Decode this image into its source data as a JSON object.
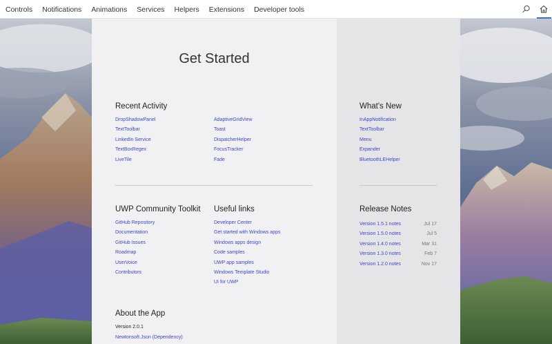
{
  "nav": {
    "items": [
      "Controls",
      "Notifications",
      "Animations",
      "Services",
      "Helpers",
      "Extensions",
      "Developer tools"
    ]
  },
  "page": {
    "title": "Get Started"
  },
  "recent_activity": {
    "title": "Recent Activity",
    "col1": [
      "DropShadowPanel",
      "TextToolbar",
      "LinkedIn Service",
      "TextBoxRegex",
      "LiveTile"
    ],
    "col2": [
      "AdaptiveGridView",
      "Toast",
      "DispatcherHelper",
      "FocusTracker",
      "Fade"
    ]
  },
  "whats_new": {
    "title": "What's New",
    "items": [
      "InAppNotification",
      "TextToolbar",
      "Menu",
      "Expander",
      "BluetoothLEHelper"
    ]
  },
  "toolkit": {
    "title": "UWP Community Toolkit",
    "items": [
      "GitHub Repository",
      "Documentation",
      "GitHub Issues",
      "Roadmap",
      "UserVoice",
      "Contributors"
    ]
  },
  "useful_links": {
    "title": "Useful links",
    "items": [
      "Developer Center",
      "Get started with Windows apps",
      "Windows apps design",
      "Code samples",
      "UWP app samples",
      "Windows Template Studio",
      "UI for UWP"
    ]
  },
  "release_notes": {
    "title": "Release Notes",
    "items": [
      {
        "name": "Version 1.5.1 notes",
        "date": "Jul 17"
      },
      {
        "name": "Version 1.5.0 notes",
        "date": "Jul 5"
      },
      {
        "name": "Version 1.4.0 notes",
        "date": "Mar 31"
      },
      {
        "name": "Version 1.3.0 notes",
        "date": "Feb 7"
      },
      {
        "name": "Version 1.2.0 notes",
        "date": "Nov 17"
      }
    ]
  },
  "about": {
    "title": "About the App",
    "version": "Version 2.0.1",
    "dependency_link": "Newtonsoft.Json (Dependency)"
  },
  "colors": {
    "link": "#3c46c8",
    "accent": "#3a6fd8",
    "panel_main": "#f1f1f3",
    "panel_side": "#e5e5e8"
  },
  "icons": {
    "search": "search-icon",
    "home": "home-icon"
  }
}
